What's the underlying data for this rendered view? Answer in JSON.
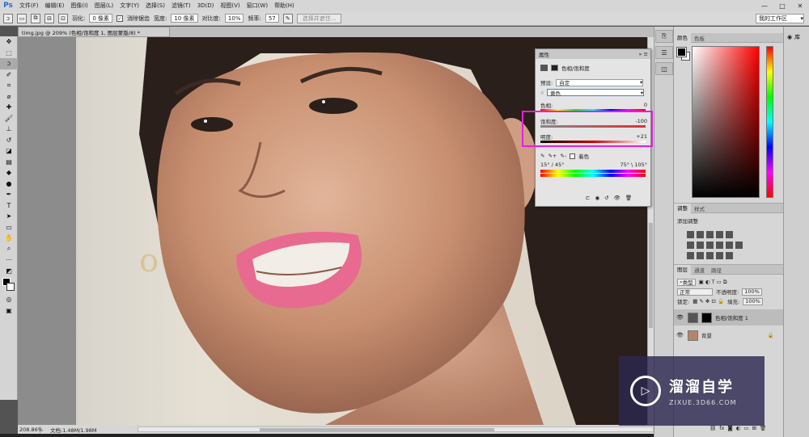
{
  "app": {
    "logo": "Ps",
    "menu": [
      "文件(F)",
      "编辑(E)",
      "图像(I)",
      "图层(L)",
      "文字(Y)",
      "选择(S)",
      "滤镜(T)",
      "3D(D)",
      "视图(V)",
      "窗口(W)",
      "帮助(H)"
    ],
    "window_controls": [
      "—",
      "□",
      "✕"
    ]
  },
  "options_bar": {
    "feather_label": "羽化:",
    "feather_value": "0 像素",
    "antialias_label": "消除锯齿",
    "style_label": "宽度:",
    "width_value": "10 像素",
    "contrast_label": "对比度:",
    "contrast_value": "10%",
    "frequency_label": "频率:",
    "frequency_value": "57",
    "select_mask_button": "选择并遮住...",
    "workspace": "我的工作区"
  },
  "document": {
    "tab_title": "timg.jpg @ 209% (色相/饱和度 1, 图层蒙版/8) *",
    "zoom": "208.86%",
    "doc_info": "文档:1.48M/1.98M"
  },
  "properties": {
    "tab": "属性",
    "title": "色相/饱和度",
    "preset_label": "预设:",
    "preset_value": "自定",
    "channel_value": "黄色",
    "hue_label": "色相:",
    "hue_value": "0",
    "saturation_label": "饱和度:",
    "saturation_value": "-100",
    "lightness_label": "明度:",
    "lightness_value": "+21",
    "colorize_label": "着色",
    "range_left": "15° / 45°",
    "range_right": "75° \\ 105°"
  },
  "panels": {
    "color_tabs": [
      "颜色",
      "色板"
    ],
    "adjust_tabs": [
      "调整",
      "样式"
    ],
    "adjust_label": "添加调整",
    "layers_tabs": [
      "图层",
      "通道",
      "路径"
    ],
    "kind_value": "类型",
    "blend_value": "正常",
    "opacity_label": "不透明度:",
    "opacity_value": "100%",
    "lock_label": "锁定:",
    "fill_label": "填充:",
    "fill_value": "100%",
    "layers": [
      {
        "name": "色相/饱和度 1"
      },
      {
        "name": "背景"
      }
    ],
    "library_label": "库"
  },
  "watermark": {
    "title": "溜溜自学",
    "url": "ZIXUE.3D66.COM"
  },
  "colors": {
    "highlight": "#e21fe0",
    "accent": "#4a7fd1"
  }
}
